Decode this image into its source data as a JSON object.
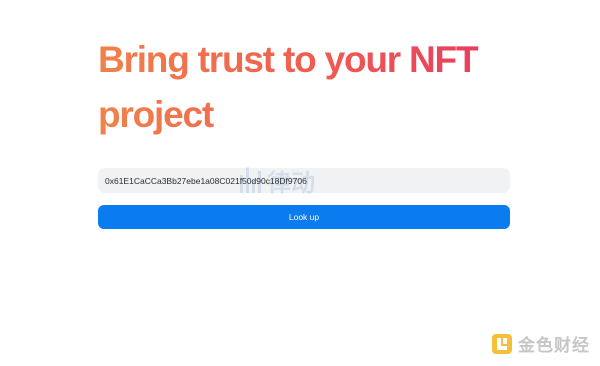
{
  "hero": {
    "title": "Bring trust to your NFT project"
  },
  "lookup": {
    "address_value": "0x61E1CaCCa3Bb27ebe1a08C021f50d90c18Df9706",
    "button_label": "Look up"
  },
  "watermarks": {
    "center_text": "律动",
    "corner_text": "金色财经"
  },
  "colors": {
    "title_gradient_start": "#f0824a",
    "title_gradient_end": "#e8365f",
    "button_bg": "#0a7cf0",
    "input_bg": "#f1f2f4"
  }
}
